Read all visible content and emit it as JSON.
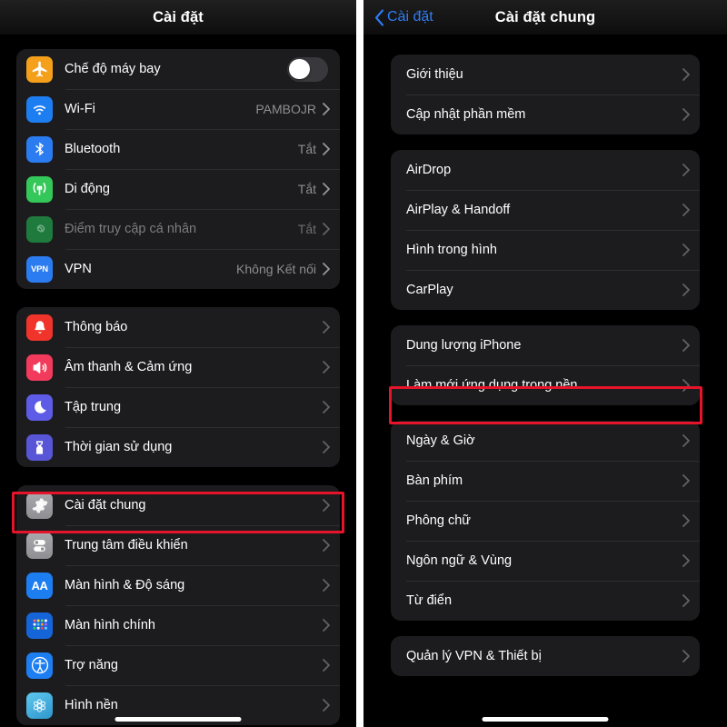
{
  "accent": "#2f7cf6",
  "highlight_color": "#e6142a",
  "card_bg": "#1c1c1e",
  "page_bg": "#000000",
  "left_panel": {
    "nav": {
      "title": "Cài đặt"
    },
    "groups": [
      {
        "rows": [
          {
            "label": "Chế độ máy bay",
            "icon": "airplane-icon",
            "icon_bg": "#f5a01b",
            "control": "toggle",
            "toggle_on": false
          },
          {
            "label": "Wi-Fi",
            "icon": "wifi-icon",
            "icon_bg": "#1d7ef2",
            "value": "PAMBOJR",
            "chevron": true
          },
          {
            "label": "Bluetooth",
            "icon": "bluetooth-icon",
            "icon_bg": "#2b7cf0",
            "value": "Tắt",
            "chevron": true
          },
          {
            "label": "Di động",
            "icon": "cellular-icon",
            "icon_bg": "#34c759",
            "value": "Tắt",
            "chevron": true
          },
          {
            "label": "Điểm truy cập cá nhân",
            "icon": "hotspot-icon",
            "icon_bg": "#1f7a3d",
            "value": "Tắt",
            "chevron": true,
            "dim": true
          },
          {
            "label": "VPN",
            "icon": "vpn-icon",
            "icon_bg": "#2b7cf0",
            "value": "Không Kết nối",
            "chevron": true
          }
        ]
      },
      {
        "rows": [
          {
            "label": "Thông báo",
            "icon": "bell-icon",
            "icon_bg": "#f0342b",
            "chevron": true
          },
          {
            "label": "Âm thanh & Cảm ứng",
            "icon": "speaker-icon",
            "icon_bg": "#f23b5c",
            "chevron": true
          },
          {
            "label": "Tập trung",
            "icon": "moon-icon",
            "icon_bg": "#5e5ce6",
            "chevron": true
          },
          {
            "label": "Thời gian sử dụng",
            "icon": "hourglass-icon",
            "icon_bg": "#5856d6",
            "chevron": true
          }
        ]
      },
      {
        "rows": [
          {
            "label": "Cài đặt chung",
            "icon": "gear-icon",
            "icon_bg": "#8e8e93",
            "chevron": true,
            "highlighted": true
          },
          {
            "label": "Trung tâm điều khiển",
            "icon": "control-center-icon",
            "icon_bg": "#8e8e93",
            "chevron": true
          },
          {
            "label": "Màn hình & Độ sáng",
            "icon": "display-aa-icon",
            "icon_bg": "#1d7ef2",
            "chevron": true
          },
          {
            "label": "Màn hình chính",
            "icon": "home-screen-grid-icon",
            "icon_bg": "#1665d8",
            "chevron": true
          },
          {
            "label": "Trợ năng",
            "icon": "accessibility-icon",
            "icon_bg": "#1d7ef2",
            "chevron": true
          },
          {
            "label": "Hình nền",
            "icon": "wallpaper-icon",
            "icon_bg": "#3ea8e0",
            "chevron": true
          }
        ]
      }
    ]
  },
  "right_panel": {
    "nav": {
      "back_label": "Cài đặt",
      "title": "Cài đặt chung"
    },
    "groups": [
      {
        "rows": [
          {
            "label": "Giới thiệu",
            "chevron": true
          },
          {
            "label": "Cập nhật phần mềm",
            "chevron": true
          }
        ]
      },
      {
        "rows": [
          {
            "label": "AirDrop",
            "chevron": true
          },
          {
            "label": "AirPlay & Handoff",
            "chevron": true
          },
          {
            "label": "Hình trong hình",
            "chevron": true
          },
          {
            "label": "CarPlay",
            "chevron": true
          }
        ]
      },
      {
        "rows": [
          {
            "label": "Dung lượng iPhone",
            "chevron": true
          },
          {
            "label": "Làm mới ứng dụng trong nền",
            "chevron": true,
            "highlighted": true
          }
        ]
      },
      {
        "rows": [
          {
            "label": "Ngày & Giờ",
            "chevron": true
          },
          {
            "label": "Bàn phím",
            "chevron": true
          },
          {
            "label": "Phông chữ",
            "chevron": true
          },
          {
            "label": "Ngôn ngữ & Vùng",
            "chevron": true
          },
          {
            "label": "Từ điển",
            "chevron": true
          }
        ]
      },
      {
        "rows": [
          {
            "label": "Quản lý VPN & Thiết bị",
            "chevron": true
          }
        ]
      }
    ]
  }
}
